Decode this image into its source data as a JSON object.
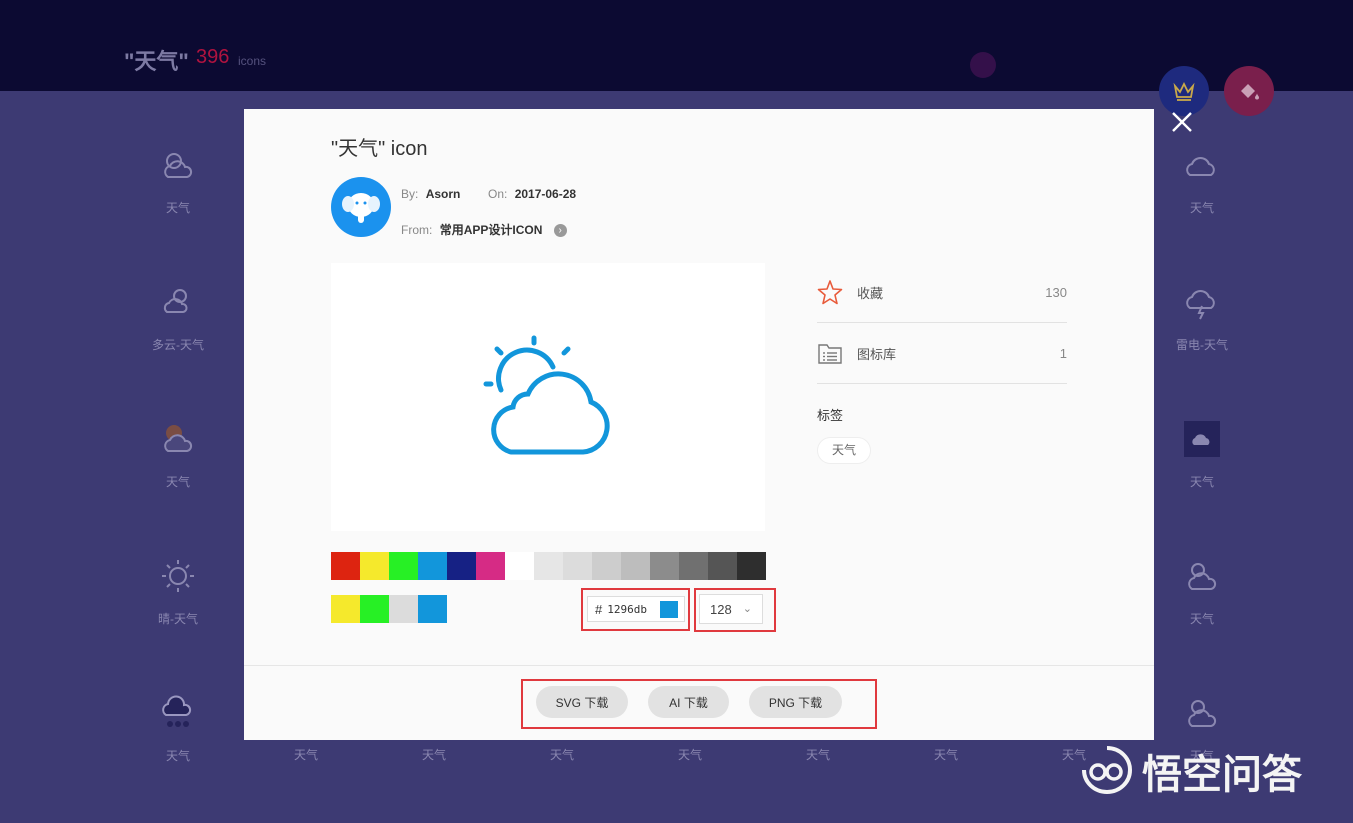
{
  "header": {
    "title": "\"天气\"",
    "count": "396",
    "unit": "icons"
  },
  "background": {
    "left_labels": [
      "天气",
      "多云-天气",
      "天气",
      "晴-天气",
      "天气"
    ],
    "right_labels": [
      "天气",
      "雷电-天气",
      "天气",
      "天气",
      "天气"
    ],
    "bottom_labels": [
      "天气",
      "天气",
      "天气",
      "天气",
      "天气",
      "天气",
      "天气"
    ]
  },
  "modal": {
    "title": "\"天气\" icon",
    "by_label": "By:",
    "author": "Asorn",
    "on_label": "On:",
    "date": "2017-06-28",
    "from_label": "From:",
    "collection": "常用APP设计ICON",
    "palette": [
      "#dd2410",
      "#f5e92c",
      "#27f025",
      "#1296db",
      "#162184",
      "#d62b85",
      "#ffffff",
      "#e6e6e6",
      "#dcdcdc",
      "#cdcdcd",
      "#bdbdbd",
      "#8c8c8c",
      "#707070",
      "#555555",
      "#2e2e2e"
    ],
    "recent_colors": [
      "#f5e92c",
      "#27f025",
      "#dcdcdc",
      "#1296db"
    ],
    "hex_prefix": "#",
    "hex_value": "1296db",
    "size_value": "128",
    "stats": [
      {
        "label": "收藏",
        "value": "130",
        "icon": "star-icon"
      },
      {
        "label": "图标库",
        "value": "1",
        "icon": "library-icon"
      }
    ],
    "tags_heading": "标签",
    "tags": [
      "天气"
    ],
    "downloads": [
      "SVG 下载",
      "AI 下载",
      "PNG 下载"
    ]
  },
  "watermark": {
    "text": "悟空问答"
  },
  "colors": {
    "icon_blue": "#1296db",
    "highlight_red": "#e0393e",
    "top_bar": "#0c0a32",
    "page_bg": "#3d3a73"
  }
}
